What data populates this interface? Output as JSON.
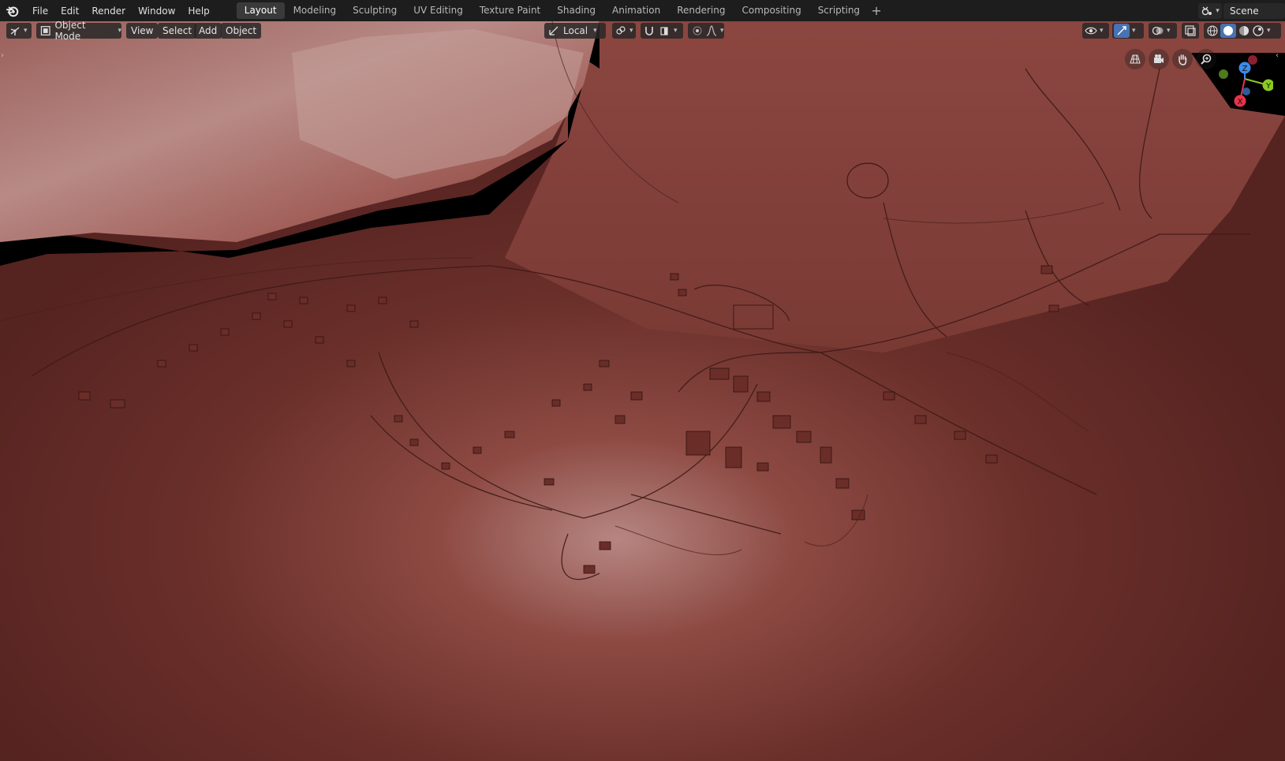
{
  "topbar": {
    "menus": [
      "File",
      "Edit",
      "Render",
      "Window",
      "Help"
    ],
    "workspaces": [
      "Layout",
      "Modeling",
      "Sculpting",
      "UV Editing",
      "Texture Paint",
      "Shading",
      "Animation",
      "Rendering",
      "Compositing",
      "Scripting"
    ],
    "active_workspace": "Layout",
    "add_tab_symbol": "+",
    "scene_name": "Scene"
  },
  "viewport_header": {
    "mode": "Object Mode",
    "menus": [
      "View",
      "Select",
      "Add",
      "Object"
    ],
    "transform_orientation": "Local"
  },
  "gizmo": {
    "x_label": "X",
    "y_label": "Y",
    "z_label": "Z"
  },
  "colors": {
    "topbar_bg": "#1d1d1d",
    "viewport_bg": "#5a2622",
    "terrain": "#7a3a34",
    "axis_x": "#e8334a",
    "axis_y": "#8bc923",
    "axis_z": "#3d8be8",
    "active_tab": "#3a3a3a"
  }
}
